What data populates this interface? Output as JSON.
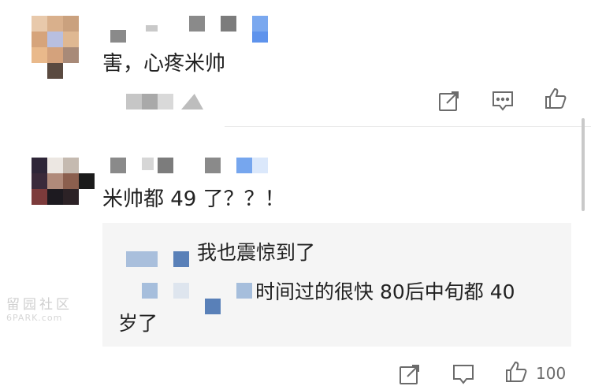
{
  "comment1": {
    "text": "害，心疼米帅"
  },
  "comment2": {
    "text": "米帅都 49 了？？！",
    "replies": [
      {
        "text": "我也震惊到了"
      },
      {
        "text": "时间过的很快 80后中旬都 40",
        "text_cont": "岁了"
      }
    ],
    "footer_count": "100"
  },
  "watermark": {
    "line1": "留园社区",
    "line2": "6PARK.com"
  },
  "icons": [
    "share-icon",
    "comment-icon",
    "like-icon"
  ],
  "colors": {
    "text": "#222222",
    "icon": "#6b6b6b",
    "reply_bg": "#f5f5f5",
    "divider": "#e9e9e9"
  }
}
